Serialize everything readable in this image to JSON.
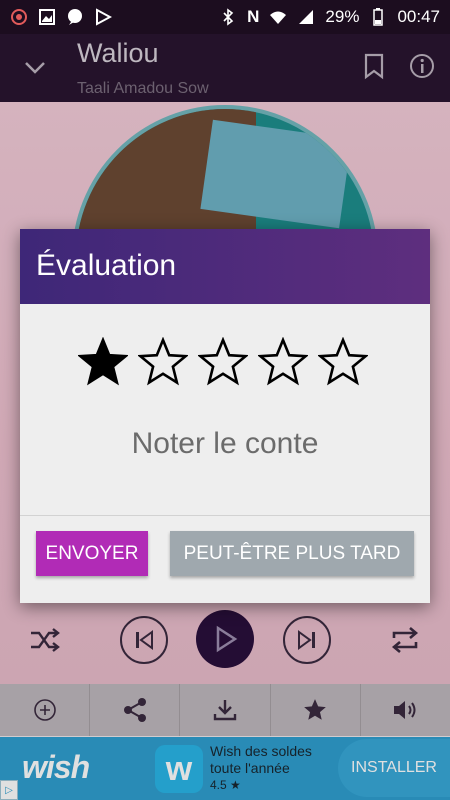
{
  "status_bar": {
    "battery": "29%",
    "time": "00:47",
    "network_letter": "N"
  },
  "player": {
    "title": "Waliou",
    "subtitle": "Taali Amadou Sow"
  },
  "dialog": {
    "title": "Évaluation",
    "rating": 1,
    "max_rating": 5,
    "message": "Noter le conte",
    "send_label": "ENVOYER",
    "later_label": "PEUT-ÊTRE PLUS TARD"
  },
  "ad": {
    "brand": "wish",
    "text_line1": "Wish des soldes",
    "text_line2": "toute l'année",
    "rating": "4.5 ★",
    "install_label": "INSTALLER",
    "app_icon_letter": "w"
  },
  "colors": {
    "dialog_header_start": "#3e2778",
    "dialog_header_end": "#5e2e7e",
    "send_button": "#b12bb6",
    "later_button": "#9fa8ae",
    "ad_background": "#2f9fd0"
  }
}
